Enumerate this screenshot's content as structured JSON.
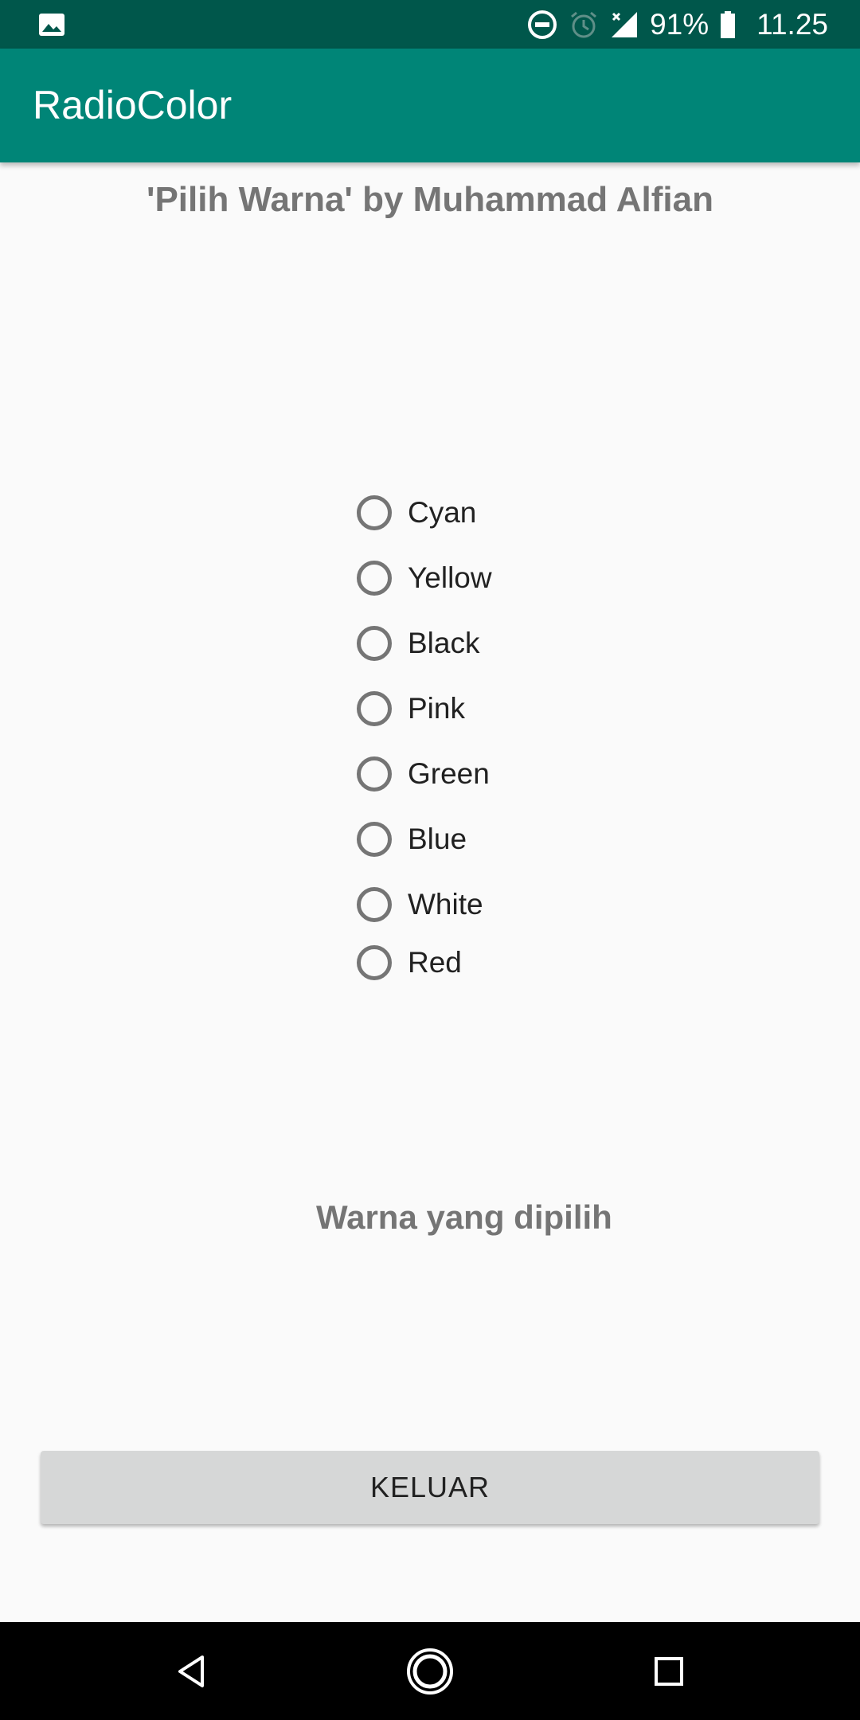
{
  "status_bar": {
    "battery_percent": "91%",
    "time": "11.25",
    "icons": [
      "image-icon",
      "dnd-icon",
      "alarm-icon",
      "signal-icon",
      "battery-icon"
    ],
    "background": "#00574b"
  },
  "app_bar": {
    "title": "RadioColor",
    "background": "#008577"
  },
  "main": {
    "heading": "'Pilih Warna' by Muhammad Alfian",
    "radio_options": [
      "Cyan",
      "Yellow",
      "Black",
      "Pink",
      "Green",
      "Blue",
      "White",
      "Red"
    ],
    "selected_option": null,
    "result_label": "Warna yang dipilih",
    "exit_button_label": "KELUAR"
  },
  "nav_bar": {
    "icons": [
      "back-icon",
      "home-icon",
      "recents-icon"
    ]
  }
}
